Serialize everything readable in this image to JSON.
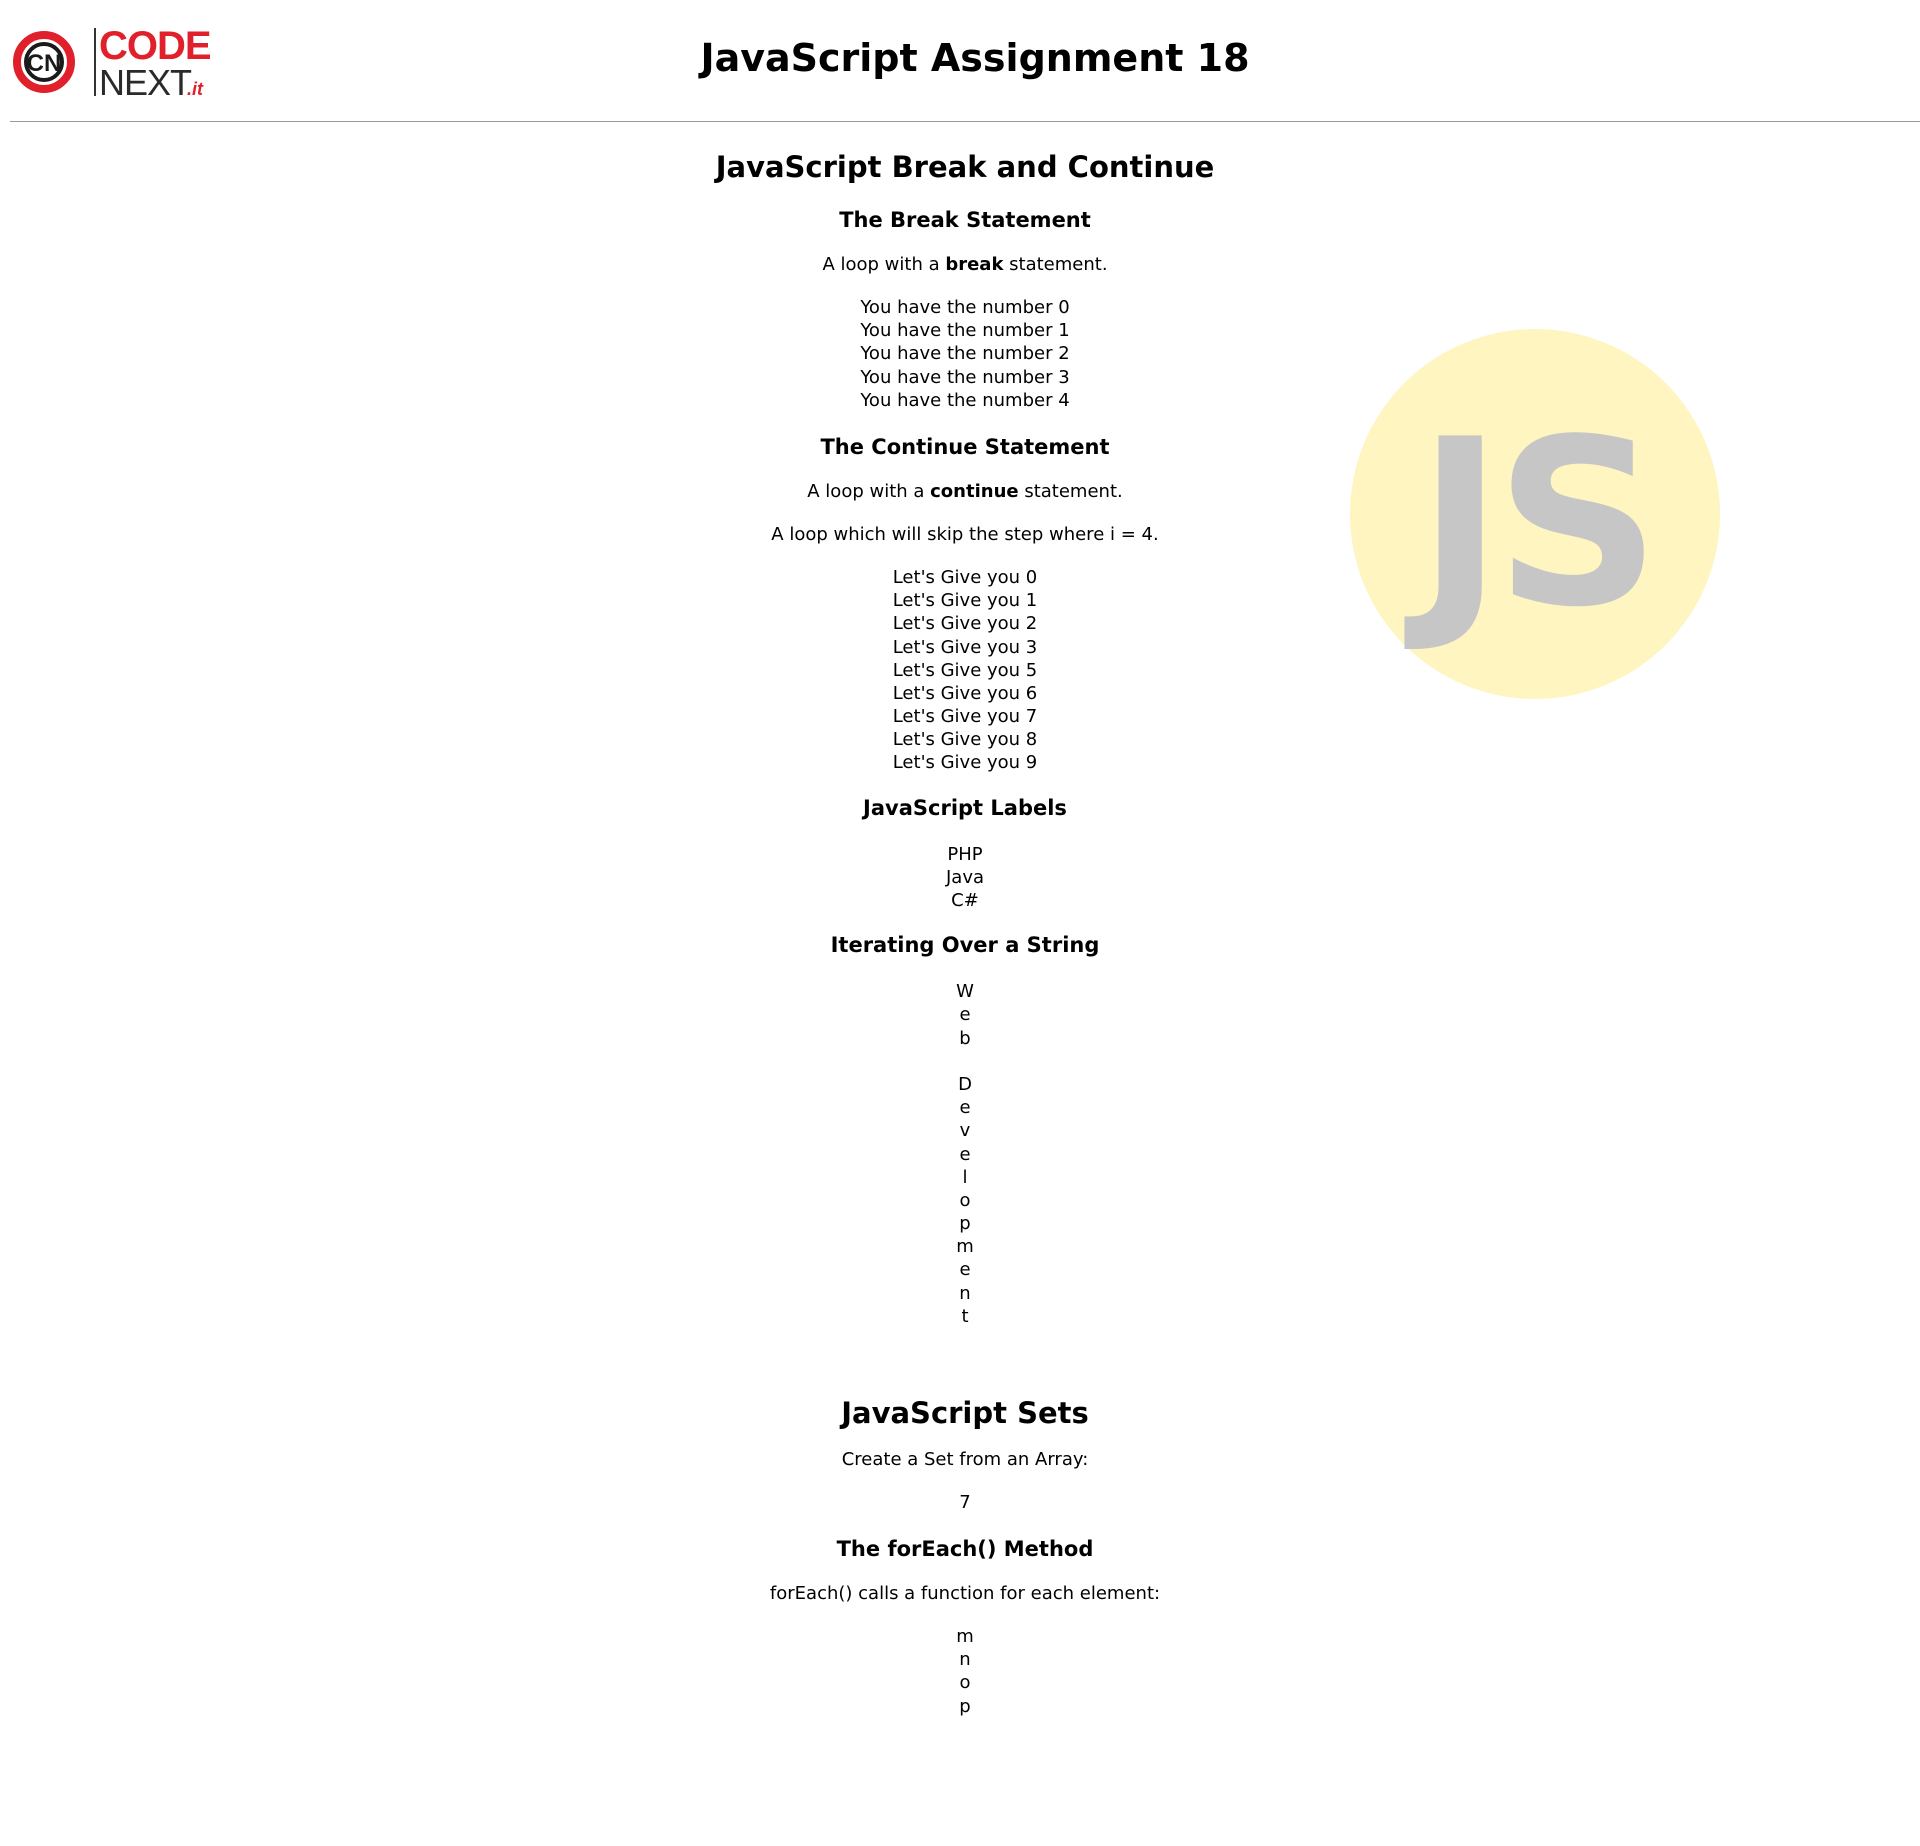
{
  "header": {
    "title": "JavaScript Assignment 18",
    "logo": {
      "line1": "CODE",
      "line2": "NEXT",
      "suffix": ".it",
      "monogram": "CN",
      "brand_red": "#e0202b"
    }
  },
  "decoration": {
    "badge_text": "JS",
    "badge_bg": "#fff5c0",
    "badge_fg": "#c6c6c6"
  },
  "break_continue": {
    "heading": "JavaScript Break and Continue",
    "break": {
      "heading": "The Break Statement",
      "desc_pre": "A loop with a ",
      "desc_keyword": "break",
      "desc_post": " statement.",
      "output": [
        "You have the number 0",
        "You have the number 1",
        "You have the number 2",
        "You have the number 3",
        "You have the number 4"
      ]
    },
    "continue": {
      "heading": "The Continue Statement",
      "desc_pre": "A loop with a ",
      "desc_keyword": "continue",
      "desc_post": " statement.",
      "note": "A loop which will skip the step where i = 4.",
      "output": [
        "Let's Give you 0",
        "Let's Give you 1",
        "Let's Give you 2",
        "Let's Give you 3",
        "Let's Give you 5",
        "Let's Give you 6",
        "Let's Give you 7",
        "Let's Give you 8",
        "Let's Give you 9"
      ]
    },
    "labels": {
      "heading": "JavaScript Labels",
      "output": [
        "PHP",
        "Java",
        "C#"
      ]
    },
    "string_iter": {
      "heading": "Iterating Over a String",
      "output": [
        "W",
        "e",
        "b",
        "",
        "D",
        "e",
        "v",
        "e",
        "l",
        "o",
        "p",
        "m",
        "e",
        "n",
        "t"
      ]
    }
  },
  "sets": {
    "heading": "JavaScript Sets",
    "desc": "Create a Set from an Array:",
    "value": "7",
    "foreach": {
      "heading": "The forEach() Method",
      "desc": "forEach() calls a function for each element:",
      "output": [
        "m",
        "n",
        "o",
        "p"
      ]
    }
  }
}
